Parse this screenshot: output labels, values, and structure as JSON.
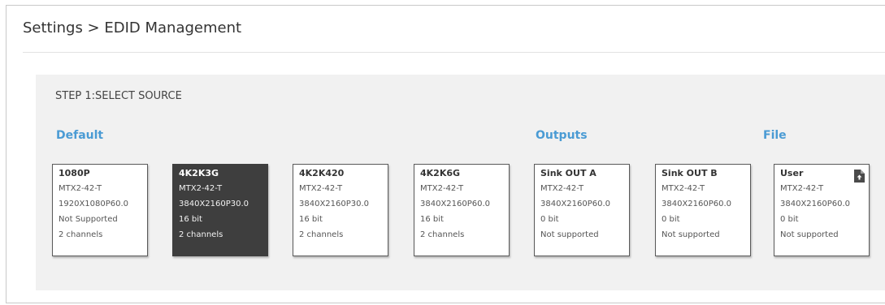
{
  "breadcrumb": "Settings > EDID Management",
  "step_label": "STEP 1:SELECT SOURCE",
  "groups": {
    "default": "Default",
    "outputs": "Outputs",
    "file": "File"
  },
  "colors": {
    "accent": "#4a9bd4",
    "selected_bg": "#3e3e3e",
    "panel_bg": "#f1f1f1"
  },
  "cards": [
    {
      "title": "1080P",
      "lines": [
        "MTX2-42-T",
        "1920X1080P60.0",
        "Not Supported",
        "2 channels"
      ],
      "selected": false
    },
    {
      "title": "4K2K3G",
      "lines": [
        "MTX2-42-T",
        "3840X2160P30.0",
        "16 bit",
        "2 channels"
      ],
      "selected": true
    },
    {
      "title": "4K2K420",
      "lines": [
        "MTX2-42-T",
        "3840X2160P30.0",
        "16 bit",
        "2 channels"
      ],
      "selected": false
    },
    {
      "title": "4K2K6G",
      "lines": [
        "MTX2-42-T",
        "3840X2160P60.0",
        "16 bit",
        "2 channels"
      ],
      "selected": false
    },
    {
      "title": "Sink OUT A",
      "lines": [
        "MTX2-42-T",
        "3840X2160P60.0",
        "0 bit",
        "Not supported"
      ],
      "selected": false
    },
    {
      "title": "Sink OUT B",
      "lines": [
        "MTX2-42-T",
        "3840X2160P60.0",
        "0 bit",
        "Not supported"
      ],
      "selected": false
    },
    {
      "title": "User",
      "lines": [
        "MTX2-42-T",
        "3840X2160P60.0",
        "0 bit",
        "Not supported"
      ],
      "selected": false,
      "icon": "file-upload-icon"
    }
  ]
}
